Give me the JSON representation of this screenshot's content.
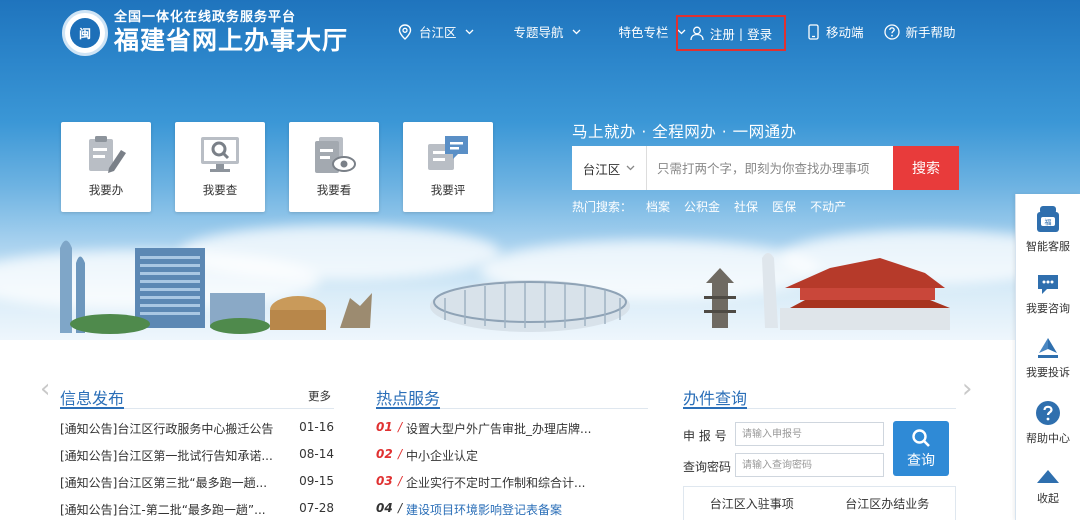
{
  "header": {
    "logo_emblem_text": "闽",
    "logo_subtitle": "全国一体化在线政务服务平台",
    "logo_title": "福建省网上办事大厅"
  },
  "nav": {
    "region": "台江区",
    "topics": "专题导航",
    "features": "特色专栏",
    "register": "注册",
    "login": "登录",
    "mobile": "移动端",
    "help": "新手帮助"
  },
  "tiles": [
    {
      "label": "我要办",
      "icon": "clipboard-pen-icon"
    },
    {
      "label": "我要查",
      "icon": "monitor-search-icon"
    },
    {
      "label": "我要看",
      "icon": "document-eye-icon"
    },
    {
      "label": "我要评",
      "icon": "chat-comment-icon"
    }
  ],
  "search": {
    "slogan": "马上就办 · 全程网办 · 一网通办",
    "region": "台江区",
    "placeholder": "只需打两个字，即刻为你查找办理事项",
    "button": "搜索",
    "hot_label": "热门搜索：",
    "hot_terms": [
      "档案",
      "公积金",
      "社保",
      "医保",
      "不动产"
    ]
  },
  "float_sidebar": [
    {
      "label": "智能客服",
      "icon": "robot-icon"
    },
    {
      "label": "我要咨询",
      "icon": "chat-bubble-icon"
    },
    {
      "label": "我要投诉",
      "icon": "paper-plane-icon"
    },
    {
      "label": "帮助中心",
      "icon": "help-circle-icon"
    },
    {
      "label": "收起",
      "icon": "collapse-up-icon"
    }
  ],
  "news": {
    "title": "信息发布",
    "more": "更多",
    "items": [
      {
        "title": "[通知公告]台江区行政服务中心搬迁公告",
        "date": "01-16"
      },
      {
        "title": "[通知公告]台江区第一批试行告知承诺...",
        "date": "08-14"
      },
      {
        "title": "[通知公告]台江区第三批“最多跑一趟...",
        "date": "09-15"
      },
      {
        "title": "[通知公告]台江-第二批“最多跑一趟”...",
        "date": "07-28"
      }
    ]
  },
  "hot_services": {
    "title": "热点服务",
    "items": [
      {
        "num": "01",
        "text": "设置大型户外广告审批_办理店牌..."
      },
      {
        "num": "02",
        "text": "中小企业认定"
      },
      {
        "num": "03",
        "text": "企业实行不定时工作制和综合计..."
      },
      {
        "num": "04",
        "text": "建设项目环境影响登记表备案"
      }
    ]
  },
  "query": {
    "title": "办件查询",
    "apply_no_label": "申 报 号",
    "apply_no_placeholder": "请输入申报号",
    "password_label": "查询密码",
    "password_placeholder": "请输入查询密码",
    "button": "查询",
    "tabs": [
      "台江区入驻事项",
      "台江区办结业务"
    ]
  },
  "colors": {
    "brand_blue": "#2b6fb8",
    "search_red": "#e83b3b",
    "highlight_red": "#e03131"
  }
}
